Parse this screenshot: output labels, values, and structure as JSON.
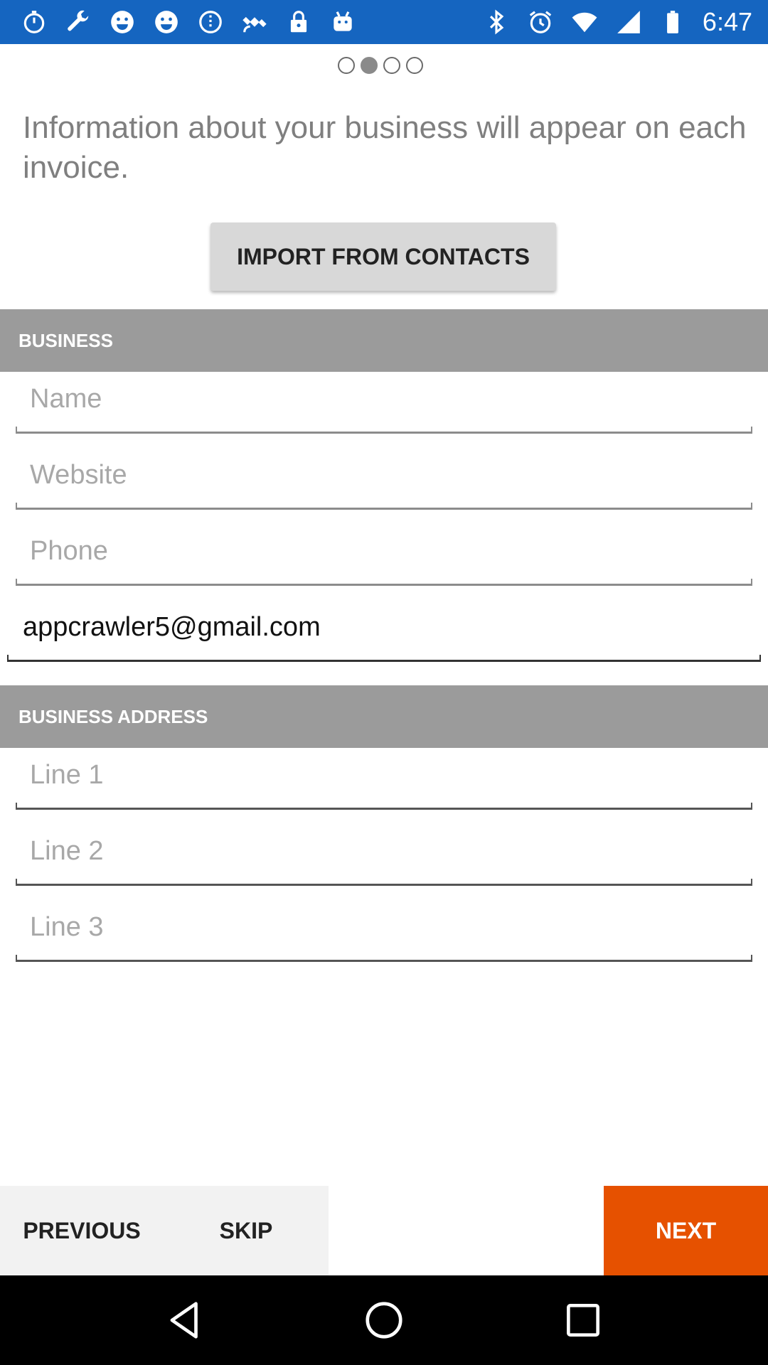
{
  "status_bar": {
    "time": "6:47",
    "left_icons": [
      "stopwatch-icon",
      "wrench-icon",
      "smiley-icon",
      "smiley-icon",
      "cellular-slash-icon",
      "satellite-icon",
      "lock-icon",
      "android-icon"
    ],
    "right_icons": [
      "bluetooth-icon",
      "alarm-icon",
      "wifi-icon",
      "signal-icon",
      "battery-icon"
    ],
    "background": "#1565c0"
  },
  "pager": {
    "count": 4,
    "active_index": 1
  },
  "intro_text": "Information about your business will appear on each invoice.",
  "import_button": "IMPORT FROM CONTACTS",
  "business_section": {
    "title": "BUSINESS",
    "name_placeholder": "Name",
    "website_placeholder": "Website",
    "phone_placeholder": "Phone",
    "email_value": "appcrawler5@gmail.com"
  },
  "address_section": {
    "title": "BUSINESS ADDRESS",
    "line1_placeholder": "Line 1",
    "line2_placeholder": "Line 2",
    "line3_placeholder": "Line 3"
  },
  "buttons": {
    "previous": "PREVIOUS",
    "skip": "SKIP",
    "next": "NEXT"
  },
  "colors": {
    "accent": "#e65100",
    "section_header": "#9b9b9b"
  }
}
